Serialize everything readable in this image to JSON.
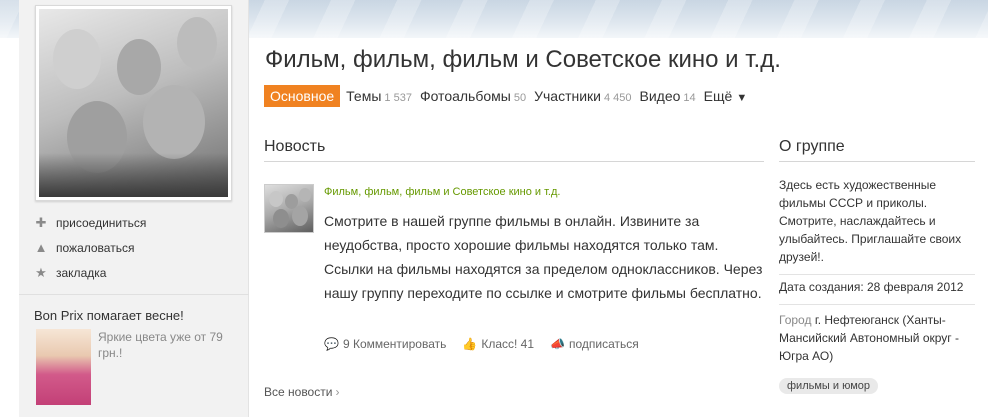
{
  "group": {
    "title": "Фильм, фильм, фильм и Советское кино и т.д."
  },
  "left": {
    "actions": [
      {
        "icon": "plus-icon",
        "label": "присоединиться"
      },
      {
        "icon": "warning-icon",
        "label": "пожаловаться"
      },
      {
        "icon": "star-icon",
        "label": "закладка"
      }
    ],
    "ad": {
      "title": "Bon Prix помагает весне!",
      "text": "Яркие цвета уже от 79 грн.!"
    }
  },
  "tabs": [
    {
      "label": "Основное",
      "count": "",
      "active": true
    },
    {
      "label": "Темы",
      "count": "1 537"
    },
    {
      "label": "Фотоальбомы",
      "count": "50"
    },
    {
      "label": "Участники",
      "count": "4 450"
    },
    {
      "label": "Видео",
      "count": "14"
    },
    {
      "label": "Ещё",
      "count": "",
      "arrow": "▼"
    }
  ],
  "news": {
    "heading": "Новость",
    "post": {
      "group_name": "Фильм, фильм, фильм и Советское кино и т.д.",
      "text": "Смотрите в нашей группе фильмы в онлайн. Извините за неудобства, просто хорошие фильмы находятся только там. Ссылки на фильмы находятся за пределом одноклассников. Через нашу группу переходите по ссылке и смотрите фильмы бесплатно.",
      "comments": "9 Комментировать",
      "likes": "Класс! 41",
      "subscribe": "подписаться"
    },
    "all_news": "Все новости",
    "all_news_chevron": "›"
  },
  "about": {
    "heading": "О группе",
    "description": "Здесь есть художественные фильмы СССР и приколы. Смотрите, наслаждайтесь и улыбайтесь. Приглашайте своих друзей!.",
    "created": "Дата создания: 28 февраля 2012",
    "city_label": "Город",
    "city": "г. Нефтеюганск (Ханты-Мансийский Автономный округ - Югра АО)",
    "tag": "фильмы и юмор"
  }
}
